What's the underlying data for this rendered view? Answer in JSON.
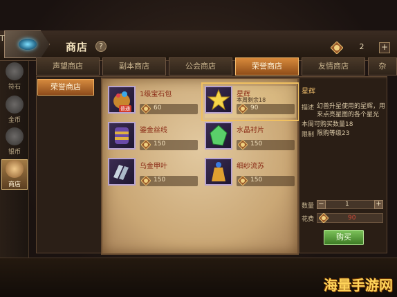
{
  "window": {
    "edge_text": "T",
    "title": "商店",
    "help_label": "?",
    "currency_amount": "2",
    "currency_add_label": "+"
  },
  "left_nav": [
    {
      "label": "符石",
      "active": false
    },
    {
      "label": "金币",
      "active": false
    },
    {
      "label": "银币",
      "active": false
    },
    {
      "label": "商店",
      "active": true
    }
  ],
  "tabs": [
    {
      "label": "声望商店",
      "active": false
    },
    {
      "label": "副本商店",
      "active": false
    },
    {
      "label": "公会商店",
      "active": false
    },
    {
      "label": "荣誉商店",
      "active": true
    },
    {
      "label": "友情商店",
      "active": false
    },
    {
      "label": "杂",
      "active": false
    }
  ],
  "subtab": {
    "label": "荣誉商店"
  },
  "items": [
    {
      "name": "1级宝石包",
      "price": "60",
      "badge": "普通",
      "stock": ""
    },
    {
      "name": "星辉",
      "price": "90",
      "stock": "本周剩余18",
      "selected": true
    },
    {
      "name": "鎏金丝线",
      "price": "150",
      "stock": ""
    },
    {
      "name": "水晶衬片",
      "price": "150",
      "stock": ""
    },
    {
      "name": "乌金甲叶",
      "price": "150",
      "stock": ""
    },
    {
      "name": "细纱流苏",
      "price": "150",
      "stock": ""
    }
  ],
  "detail": {
    "title": "星辉",
    "desc_label": "描述",
    "desc_line1": "幻兽升星使用的星辉，用",
    "desc_line2": "来点亮星图的各个星光",
    "weekly": "本周可购买数量18",
    "limit_label": "限制",
    "limit_value": "限购等级23",
    "qty_label": "数量",
    "qty_minus": "−",
    "qty_value": "1",
    "qty_plus": "+",
    "cost_label": "花费",
    "cost_value": "90",
    "buy_label": "购买"
  },
  "watermark": "海量手游网",
  "colors": {
    "accent": "#d88a3b",
    "buy": "#5fa33e",
    "price_red": "#d84a3a"
  }
}
